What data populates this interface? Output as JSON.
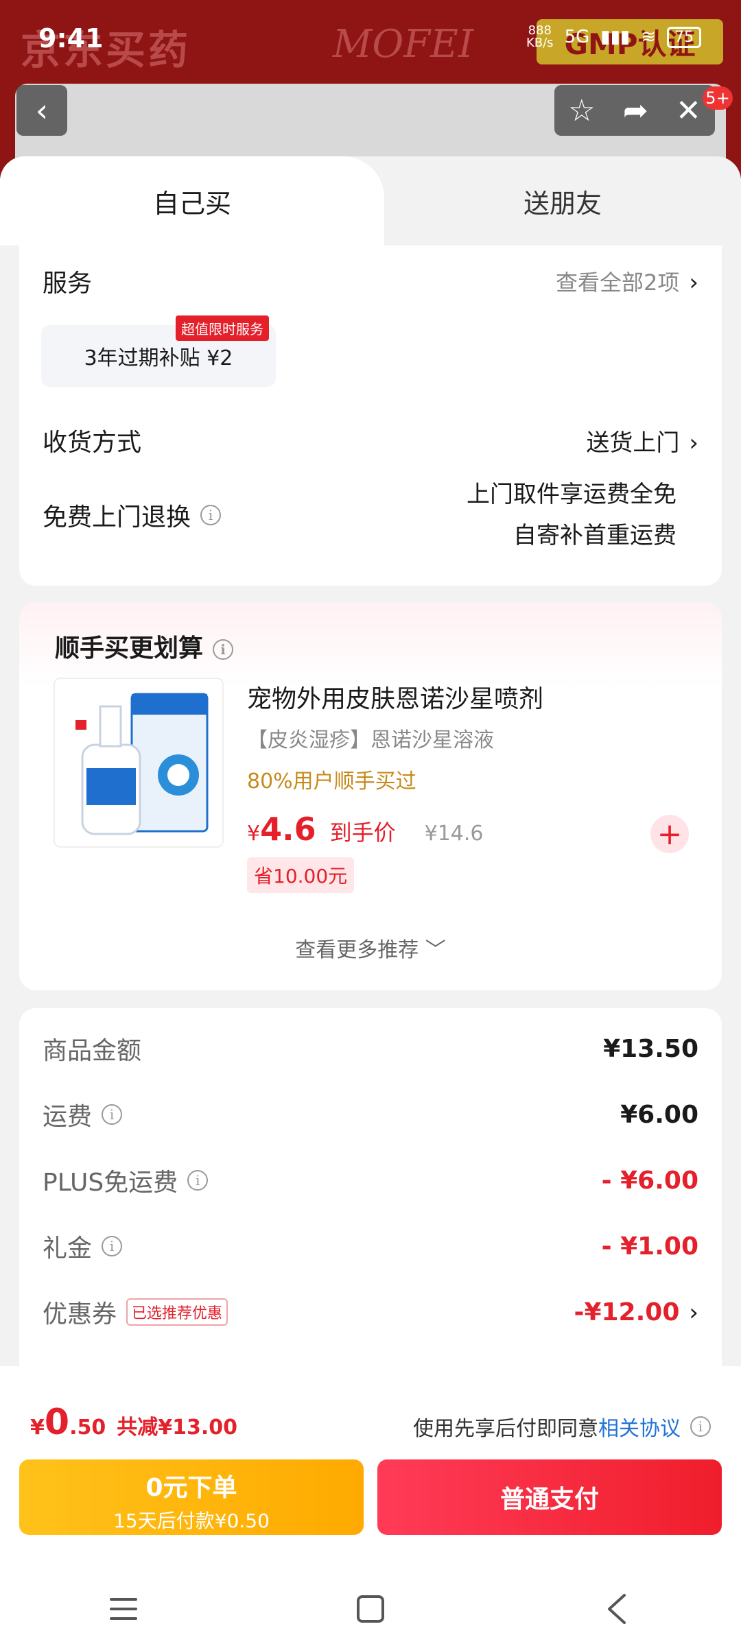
{
  "status_bar": {
    "time": "9:41",
    "network_speed_top": "888",
    "network_speed_bottom": "KB/s",
    "network_type": "5G",
    "battery": "75"
  },
  "background": {
    "brand_text": "京东买药",
    "mofei_text": "MOFEI",
    "cert_text": "GMP认证",
    "cart_badge": "5+"
  },
  "tabs": [
    {
      "label": "自己买",
      "active": true
    },
    {
      "label": "送朋友",
      "active": false
    }
  ],
  "service": {
    "label": "服务",
    "view_all": "查看全部2项",
    "chip_text": "3年过期补贴 ¥2",
    "chip_tag": "超值限时服务"
  },
  "delivery": {
    "label": "收货方式",
    "value": "送货上门"
  },
  "return": {
    "label": "免费上门退换",
    "line1": "上门取件享运费全免",
    "line2": "自寄补首重运费"
  },
  "recommend": {
    "title": "顺手买更划算",
    "product_name": "宠物外用皮肤恩诺沙星喷剂",
    "subtitle": "【皮炎湿疹】恩诺沙星溶液",
    "stat": "80%用户顺手买过",
    "price_symbol": "¥",
    "price": "4.6",
    "price_label": "到手价",
    "old_price": "¥14.6",
    "save": "省10.00元",
    "more": "查看更多推荐 ﹀"
  },
  "summary": [
    {
      "label": "商品金额",
      "value": "¥13.50",
      "info": false,
      "red": false
    },
    {
      "label": "运费",
      "value": "¥6.00",
      "info": true,
      "red": false
    },
    {
      "label": "PLUS免运费",
      "value": "- ¥6.00",
      "info": true,
      "red": true
    },
    {
      "label": "礼金",
      "value": "- ¥1.00",
      "info": true,
      "red": true
    },
    {
      "label": "优惠券",
      "value": "-¥12.00",
      "info": false,
      "red": true,
      "tag": "已选推荐优惠"
    }
  ],
  "bottom": {
    "yen": "¥",
    "total_int": "0",
    "total_dec": ".50",
    "saved": "共减¥13.00",
    "agree_prefix": "使用先享后付即同意",
    "agree_link": "相关协议",
    "zero_btn_line1": "0元下单",
    "zero_btn_line2": "15天后付款¥0.50",
    "pay_btn": "普通支付"
  },
  "colors": {
    "accent_red": "#e4202b",
    "accent_yellow": "#ffb20a",
    "link_blue": "#2173d9"
  }
}
